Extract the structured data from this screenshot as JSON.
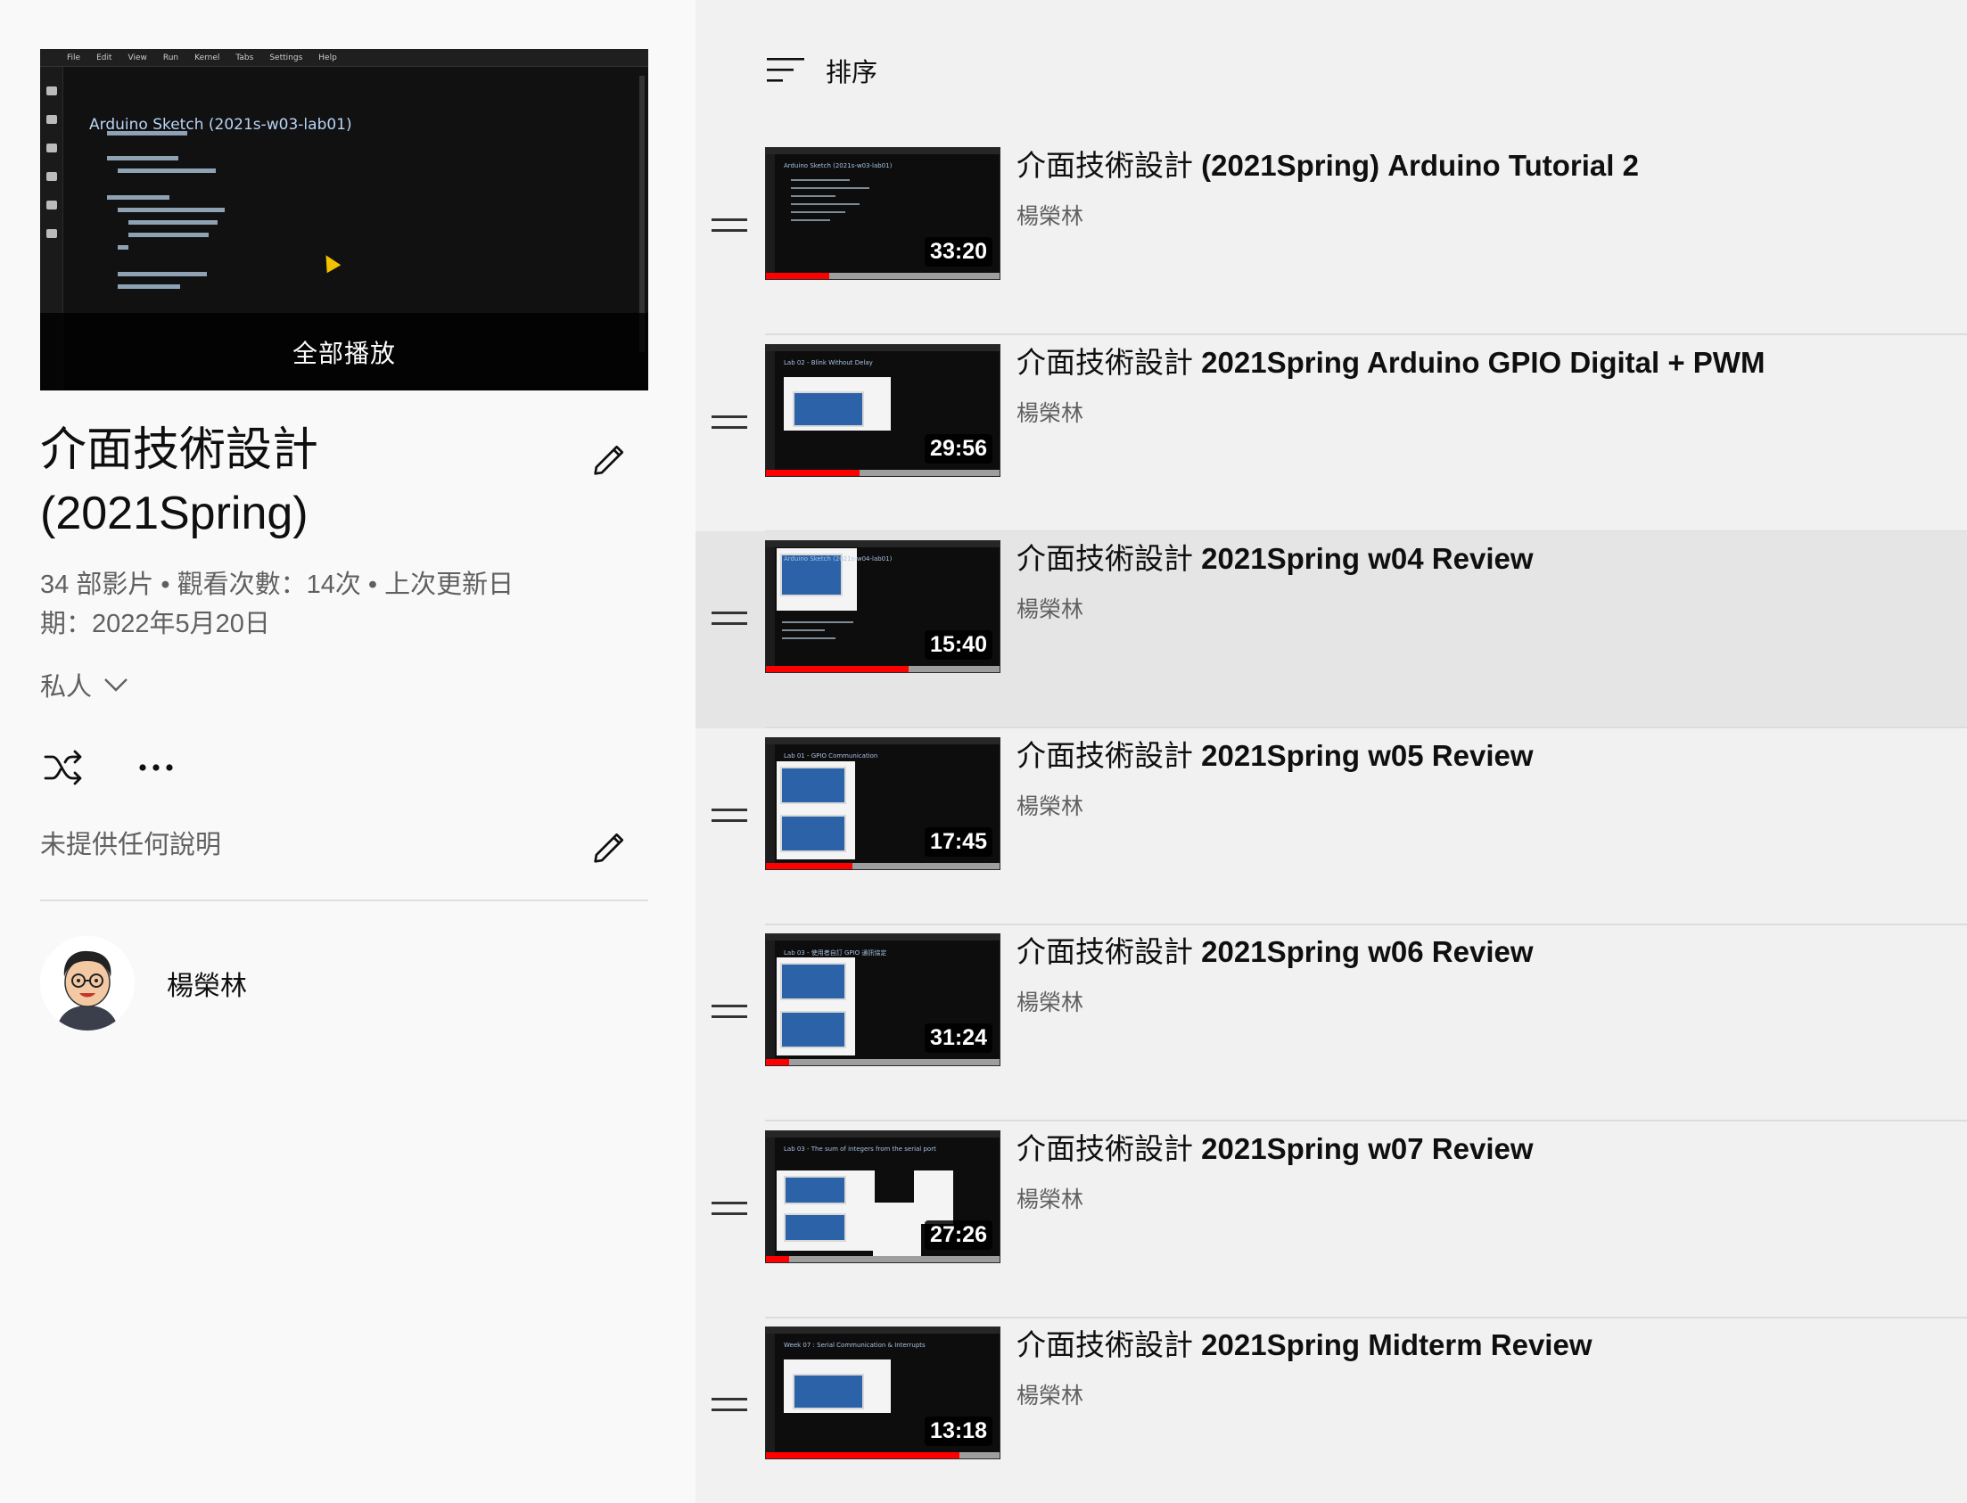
{
  "playlist": {
    "hero_label": "全部播放",
    "hero_code_title": "Arduino Sketch (2021s-w03-lab01)",
    "hero_menu": [
      "File",
      "Edit",
      "View",
      "Run",
      "Kernel",
      "Tabs",
      "Settings",
      "Help"
    ],
    "title_line1": "介面技術設計",
    "title_line2": "(2021Spring)",
    "stats_line1": "34 部影片 • 觀看次數：14次 • 上次更新日",
    "stats_line2": "期：2022年5月20日",
    "privacy": "私人",
    "description": "未提供任何說明",
    "owner": "楊榮林"
  },
  "sort": {
    "label": "排序"
  },
  "videos": [
    {
      "title_cjk": "介面技術設計",
      "title_latin": "(2021Spring) Arduino Tutorial 2",
      "channel": "楊榮林",
      "duration": "33:20",
      "progress": 0.27,
      "thumb_caption": "Arduino Sketch (2021s-w03-lab01)",
      "thumb_kind": "code"
    },
    {
      "title_cjk": "介面技術設計",
      "title_latin": "2021Spring Arduino GPIO Digital + PWM",
      "channel": "楊榮林",
      "duration": "29:56",
      "progress": 0.4,
      "thumb_caption": "Lab 02 - Blink Without Delay",
      "thumb_kind": "board-top"
    },
    {
      "title_cjk": "介面技術設計",
      "title_latin": "2021Spring w04 Review",
      "channel": "楊榮林",
      "duration": "15:40",
      "progress": 0.61,
      "thumb_caption": "Arduino Sketch (2021s-w04-lab01)",
      "thumb_kind": "board-left"
    },
    {
      "title_cjk": "介面技術設計",
      "title_latin": "2021Spring w05 Review",
      "channel": "楊榮林",
      "duration": "17:45",
      "progress": 0.37,
      "thumb_caption": "Lab 01 - GPIO Communication",
      "thumb_kind": "two-boards"
    },
    {
      "title_cjk": "介面技術設計",
      "title_latin": "2021Spring w06 Review",
      "channel": "楊榮林",
      "duration": "31:24",
      "progress": 0.1,
      "thumb_caption": "Lab 03 - 使用者自訂 GPIO 通訊協定",
      "thumb_kind": "two-boards"
    },
    {
      "title_cjk": "介面技術設計",
      "title_latin": "2021Spring w07 Review",
      "channel": "楊榮林",
      "duration": "27:26",
      "progress": 0.1,
      "thumb_caption": "Lab 03 - The sum of integers from the serial port",
      "thumb_kind": "serial"
    },
    {
      "title_cjk": "介面技術設計",
      "title_latin": "2021Spring Midterm Review",
      "channel": "楊榮林",
      "duration": "13:18",
      "progress": 0.83,
      "thumb_caption": "Week 07 : Serial Communication & Interrupts",
      "thumb_kind": "board-top"
    }
  ],
  "colors": {
    "left_bg": "#f9f9f9",
    "right_bg": "#f1f1f1",
    "hover_row": "#e5e5e5",
    "progress": "#ff0000",
    "text_secondary": "#606060"
  },
  "icons": {
    "edit": "pencil-icon",
    "shuffle": "shuffle-icon",
    "more": "more-horiz-icon",
    "privacy_dropdown": "chevron-down-icon",
    "sort": "sort-icon",
    "drag": "drag-handle-icon"
  }
}
